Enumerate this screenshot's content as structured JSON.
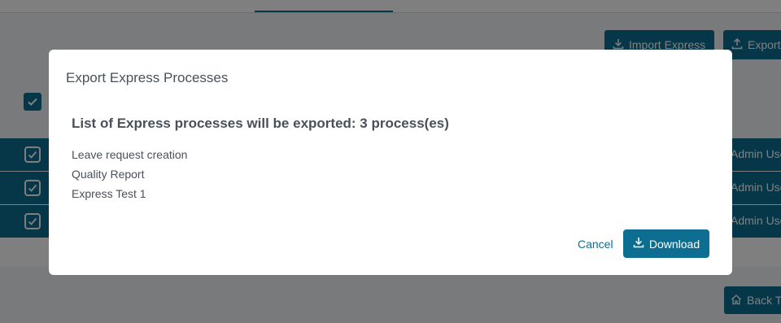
{
  "background": {
    "toolbar": {
      "import_label": "Import Express",
      "export_label": "Export"
    },
    "table": {
      "rows": [
        {
          "user": "Admin User",
          "checked": true
        },
        {
          "user": "Admin User",
          "checked": true
        },
        {
          "user": "Admin User",
          "checked": true
        }
      ]
    },
    "back_button_label": "Back To"
  },
  "modal": {
    "title": "Export Express Processes",
    "list_heading": "List of Express processes will be exported: 3 process(es)",
    "processes": [
      "Leave request creation",
      "Quality Report",
      "Express Test 1"
    ],
    "cancel_label": "Cancel",
    "download_label": "Download"
  },
  "colors": {
    "primary": "#0d6e91",
    "text": "#4a5059",
    "overlay": "rgba(0,0,0,0.5)"
  },
  "icons": {
    "import": "download-icon",
    "export": "upload-icon",
    "download": "download-icon",
    "back": "home-icon",
    "check": "checkbox-check-icon"
  }
}
